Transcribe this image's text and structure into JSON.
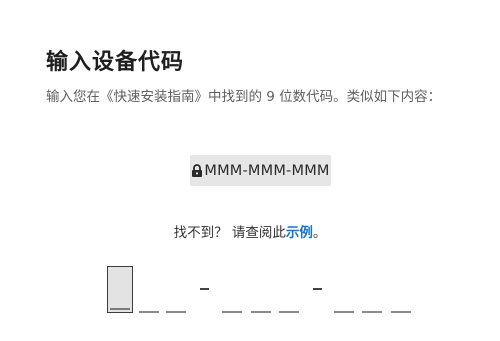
{
  "page": {
    "title": "输入设备代码",
    "description": "输入您在《快速安装指南》中找到的 9 位数代码。类似如下内容：",
    "example_code": "MMM-MMM-MMM",
    "help_prefix": "找不到？ 请查阅此",
    "help_link": "示例",
    "help_suffix": "。"
  },
  "code_input": {
    "digits": 9,
    "groups": 3,
    "active_index": 0
  },
  "icons": {
    "lock": "lock-icon"
  }
}
